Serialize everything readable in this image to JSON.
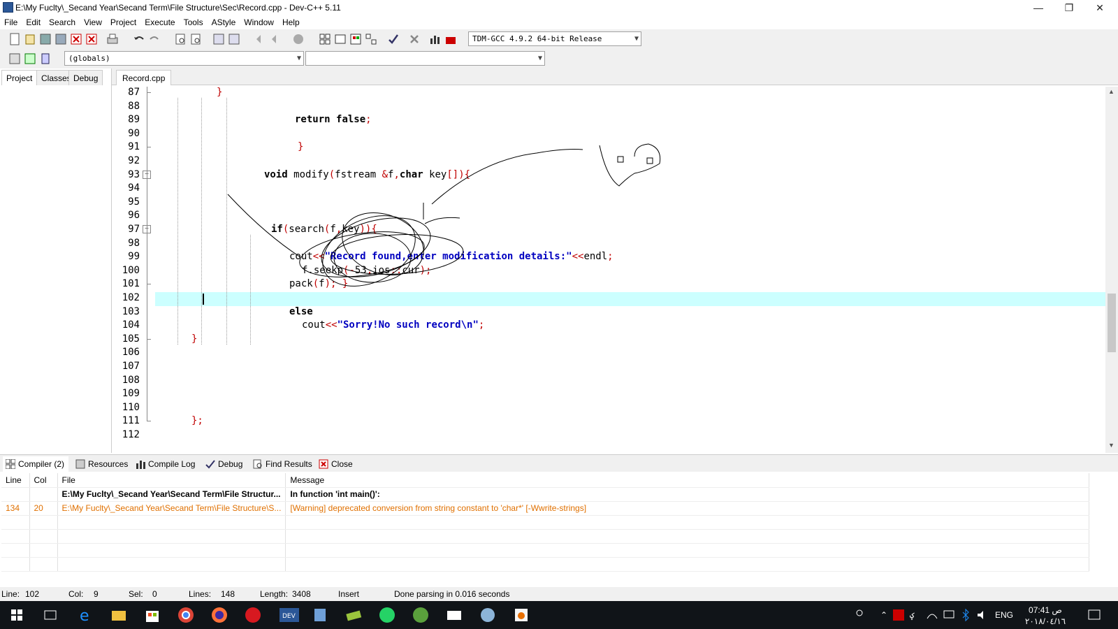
{
  "window": {
    "title": "E:\\My Fuclty\\_Secand Year\\Secand Term\\File Structure\\Sec\\Record.cpp - Dev-C++ 5.11"
  },
  "menu": [
    "File",
    "Edit",
    "Search",
    "View",
    "Project",
    "Execute",
    "Tools",
    "AStyle",
    "Window",
    "Help"
  ],
  "toolbar": {
    "compiler": "TDM-GCC 4.9.2 64-bit Release",
    "scope": "(globals)",
    "member": ""
  },
  "left_tabs": [
    "Project",
    "Classes",
    "Debug"
  ],
  "editor_tab": "Record.cpp",
  "lines": [
    {
      "n": "87",
      "code": "}"
    },
    {
      "n": "88",
      "code": ""
    },
    {
      "n": "89",
      "code": "return false;"
    },
    {
      "n": "90",
      "code": ""
    },
    {
      "n": "91",
      "code": "}"
    },
    {
      "n": "92",
      "code": ""
    },
    {
      "n": "93",
      "code": "void modify(fstream &f,char key[]){"
    },
    {
      "n": "94",
      "code": ""
    },
    {
      "n": "95",
      "code": ""
    },
    {
      "n": "96",
      "code": ""
    },
    {
      "n": "97",
      "code": "if(search(f,key)){"
    },
    {
      "n": "98",
      "code": ""
    },
    {
      "n": "99",
      "code": "cout<<\"Record found,enter modification details:\"<<endl;"
    },
    {
      "n": "100",
      "code": "f.seekp(-53,ios::cur);"
    },
    {
      "n": "101",
      "code": "pack(f); }"
    },
    {
      "n": "102",
      "code": ""
    },
    {
      "n": "103",
      "code": "else"
    },
    {
      "n": "104",
      "code": "cout<<\"Sorry!No such record\\n\";"
    },
    {
      "n": "105",
      "code": "}"
    },
    {
      "n": "106",
      "code": ""
    },
    {
      "n": "107",
      "code": ""
    },
    {
      "n": "108",
      "code": ""
    },
    {
      "n": "109",
      "code": ""
    },
    {
      "n": "110",
      "code": ""
    },
    {
      "n": "111",
      "code": "};"
    },
    {
      "n": "112",
      "code": ""
    }
  ],
  "bottom_tabs": [
    "Compiler (2)",
    "Resources",
    "Compile Log",
    "Debug",
    "Find Results",
    "Close"
  ],
  "messages": {
    "headers": [
      "Line",
      "Col",
      "File",
      "Message"
    ],
    "rows": [
      {
        "line": "",
        "col": "",
        "file": "E:\\My Fuclty\\_Secand Year\\Secand Term\\File Structur...",
        "message": "In function 'int main()':"
      },
      {
        "line": "134",
        "col": "20",
        "file": "E:\\My Fuclty\\_Secand Year\\Secand Term\\File Structure\\S...",
        "message": "[Warning] deprecated conversion from string constant to 'char*' [-Wwrite-strings]"
      }
    ]
  },
  "status": {
    "line_label": "Line:",
    "line": "102",
    "col_label": "Col:",
    "col": "9",
    "sel_label": "Sel:",
    "sel": "0",
    "lines_label": "Lines:",
    "lines": "148",
    "length_label": "Length:",
    "length": "3408",
    "mode": "Insert",
    "message": "Done parsing in 0.016 seconds"
  },
  "taskbar": {
    "lang": "ENG",
    "time": "07:41 ص",
    "date": "٢٠١٨/٠٤/١٦"
  },
  "colors": {
    "current_line": "#ccffff",
    "warning": "#e07000",
    "string": "#0000c0",
    "brace": "#c00000"
  }
}
